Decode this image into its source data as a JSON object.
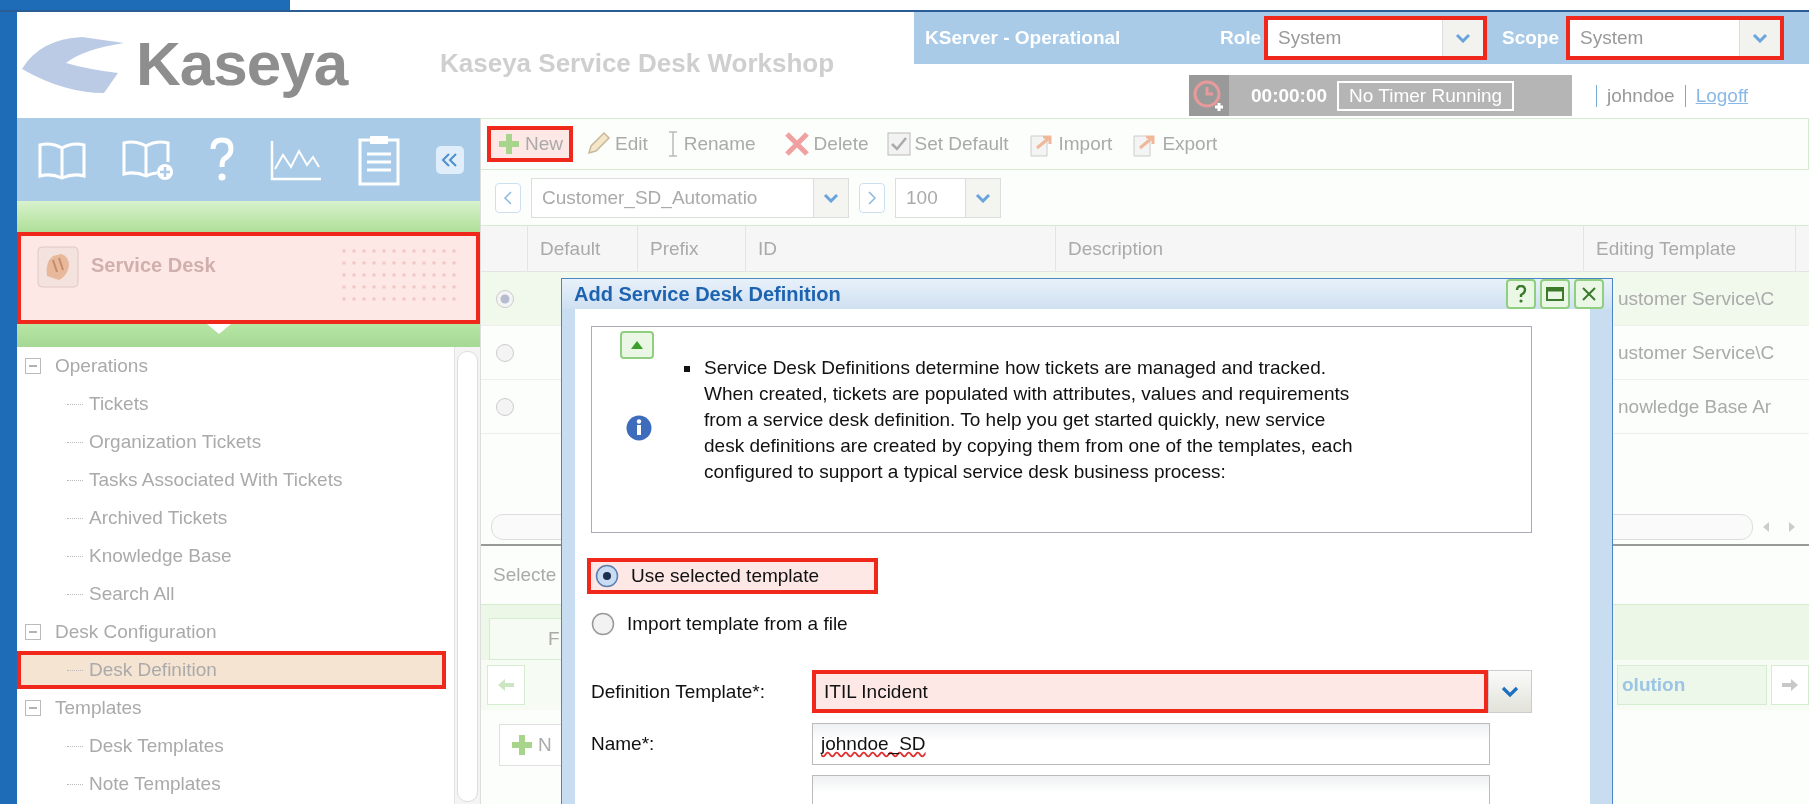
{
  "header": {
    "logo": "Kaseya",
    "title": "Kaseya Service Desk Workshop",
    "server_status": "KServer - Operational",
    "role": {
      "label": "Role",
      "value": "System",
      "highlighted": true
    },
    "scope": {
      "label": "Scope",
      "value": "System",
      "highlighted": true
    },
    "timer": {
      "time": "00:00:00",
      "status": "No Timer Running"
    },
    "user": "johndoe",
    "logoff": "Logoff"
  },
  "sidebar": {
    "module": {
      "label": "Service Desk",
      "highlighted": true
    },
    "tree": [
      {
        "label": "Operations",
        "expanded": true,
        "children": [
          {
            "label": "Tickets",
            "selected": false
          },
          {
            "label": "Organization Tickets",
            "selected": false
          },
          {
            "label": "Tasks Associated With Tickets",
            "selected": false
          },
          {
            "label": "Archived Tickets",
            "selected": false
          },
          {
            "label": "Knowledge Base",
            "selected": false
          },
          {
            "label": "Search All",
            "selected": false
          }
        ]
      },
      {
        "label": "Desk Configuration",
        "expanded": true,
        "children": [
          {
            "label": "Desk Definition",
            "selected": true
          }
        ]
      },
      {
        "label": "Templates",
        "expanded": true,
        "children": [
          {
            "label": "Desk Templates",
            "selected": false
          },
          {
            "label": "Note Templates",
            "selected": false
          }
        ]
      }
    ]
  },
  "toolbar": [
    {
      "label": "New",
      "kind": "new",
      "highlighted": true
    },
    {
      "label": "Edit",
      "kind": "edit",
      "highlighted": false
    },
    {
      "label": "Rename",
      "kind": "rename",
      "highlighted": false
    },
    {
      "label": "Delete",
      "kind": "delete",
      "highlighted": false
    },
    {
      "label": "Set Default",
      "kind": "set-default",
      "highlighted": false
    },
    {
      "label": "Import",
      "kind": "import",
      "highlighted": false
    },
    {
      "label": "Export",
      "kind": "export",
      "highlighted": false
    }
  ],
  "navigator": {
    "filter": "Customer_SD_Automatio",
    "page_size": "100"
  },
  "grid": {
    "columns": [
      "Default",
      "Prefix",
      "ID",
      "Description",
      "Editing Template"
    ],
    "rows": [
      {
        "selected": true,
        "editing_template": "ustomer Service\\C"
      },
      {
        "selected": false,
        "editing_template": "ustomer Service\\C"
      },
      {
        "selected": false,
        "editing_template": "nowledge Base Ar"
      }
    ]
  },
  "lower": {
    "caption": "Selecte",
    "tabs_top": [
      {
        "label": "F",
        "selected": false
      }
    ],
    "tabs_bottom": [
      {
        "label": "olution",
        "selected": false
      }
    ],
    "add_button": "N"
  },
  "dialog": {
    "title": "Add Service Desk Definition",
    "info": "Service Desk Definitions determine how tickets are managed and tracked. When created, tickets are populated with attributes, values and requirements from a service desk definition. To help you get started quickly, new service desk definitions are created by copying them from one of the templates, each configured to support a typical service desk business process:",
    "options": [
      {
        "label": "Use selected template",
        "selected": true,
        "highlighted": true
      },
      {
        "label": "Import template from a file",
        "selected": false,
        "highlighted": false
      }
    ],
    "fields": [
      {
        "label": "Definition Template*:",
        "value": "ITIL Incident",
        "kind": "select",
        "highlighted": true,
        "spelling_error": false
      },
      {
        "label": "Name*:",
        "value": "johndoe_SD",
        "kind": "text",
        "highlighted": false,
        "spelling_error": true
      }
    ]
  }
}
